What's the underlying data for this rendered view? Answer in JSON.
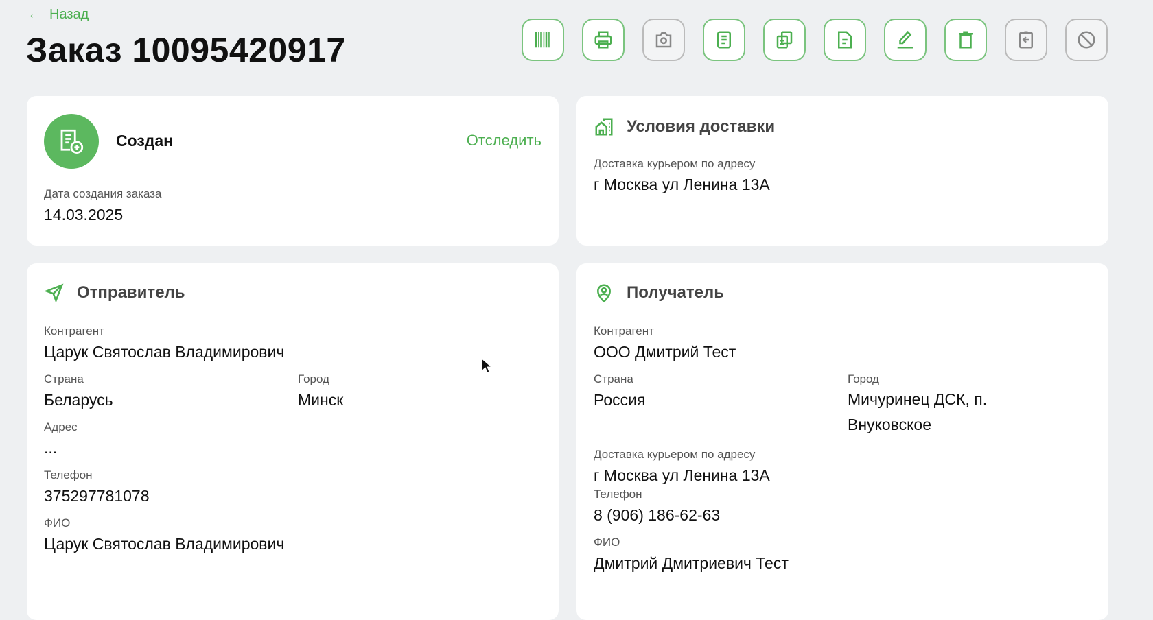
{
  "header": {
    "back_label": "Назад",
    "title": "Заказ 10095420917"
  },
  "toolbar": [
    {
      "icon": "barcode-icon",
      "active": true
    },
    {
      "icon": "printer-icon",
      "active": true
    },
    {
      "icon": "camera-icon",
      "active": false
    },
    {
      "icon": "document-icon",
      "active": true
    },
    {
      "icon": "copy-icon",
      "active": true
    },
    {
      "icon": "file-icon",
      "active": true
    },
    {
      "icon": "pencil-icon",
      "active": true
    },
    {
      "icon": "trash-icon",
      "active": true
    },
    {
      "icon": "return-icon",
      "active": false
    },
    {
      "icon": "cancel-icon",
      "active": false
    }
  ],
  "status": {
    "label": "Создан",
    "track_label": "Отследить",
    "date_label": "Дата создания заказа",
    "date": "14.03.2025"
  },
  "delivery": {
    "title": "Условия доставки",
    "method": "Доставка курьером по адресу",
    "address": "г Москва ул Ленина 13А"
  },
  "sender": {
    "title": "Отправитель",
    "counterparty_label": "Контрагент",
    "counterparty": "Царук Святослав Владимирович",
    "country_label": "Страна",
    "country": "Беларусь",
    "city_label": "Город",
    "city": "Минск",
    "address_label": "Адрес",
    "address": "...",
    "phone_label": "Телефон",
    "phone": "375297781078",
    "name_label": "ФИО",
    "name": "Царук Святослав Владимирович"
  },
  "recipient": {
    "title": "Получатель",
    "counterparty_label": "Контрагент",
    "counterparty": "ООО Дмитрий Тест",
    "country_label": "Страна",
    "country": "Россия",
    "city_label": "Город",
    "city": "Мичуринец ДСК, п. Внуковское",
    "delivery_label": "Доставка курьером по адресу",
    "delivery_address": "г Москва ул Ленина 13А",
    "phone_label": "Телефон",
    "phone": "8 (906) 186-62-63",
    "name_label": "ФИО",
    "name": "Дмитрий Дмитриевич Тест"
  }
}
